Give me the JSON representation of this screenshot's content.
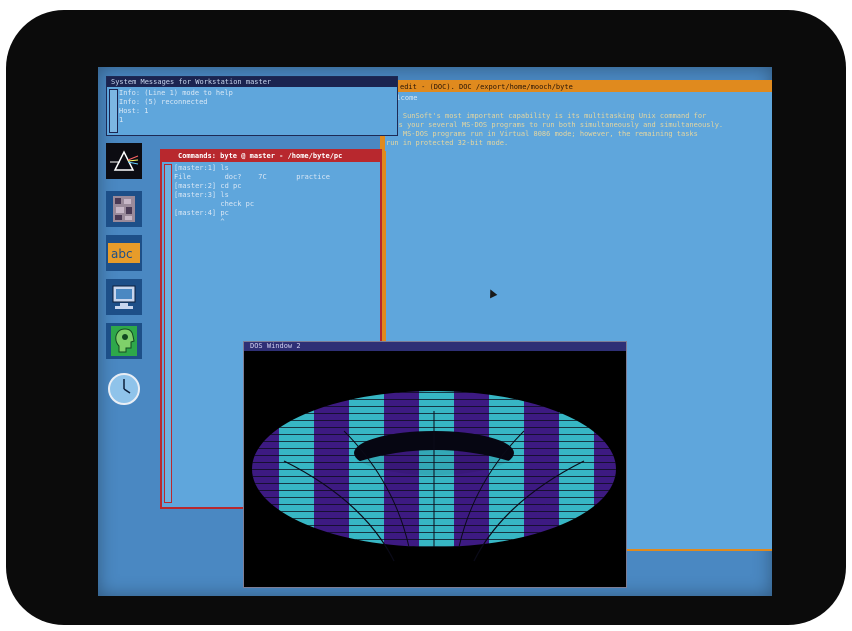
{
  "system_messages": {
    "title": "System Messages for Workstation master",
    "lines": [
      "Info: (Line 1) mode to help",
      "Info: (5) reconnected",
      "Host: 1",
      "1"
    ]
  },
  "document": {
    "title": "edit - (DOC). DOC /export/home/mooch/byte",
    "subtitle": "Welcome",
    "body_lines": [
      "The SunSoft's most important capability is its multitasking Unix command for",
      "it's your several MS-DOS programs to run both simultaneously and simultaneously.",
      "All MS-DOS programs run in Virtual 8086 mode; however, the remaining tasks",
      "run in protected 32-bit mode."
    ]
  },
  "commands": {
    "title": "Commands: byte @ master - /home/byte/pc",
    "lines": [
      "[master:1] ls",
      "File        doc?    7C       practice",
      "[master:2] cd pc",
      "[master:3] ls",
      "           check pc",
      "[master:4] pc",
      "           ^"
    ]
  },
  "dos": {
    "title": "DOS Window 2"
  },
  "colors": {
    "screen_bg": "#4a88c2",
    "torus_dark": "#3d1a82",
    "torus_light": "#37b6c4",
    "command_border": "#b8282e",
    "document_border": "#e08a1e"
  },
  "icons": [
    "prism-icon",
    "texture-icon",
    "abc-icon",
    "monitor-icon",
    "head-icon",
    "clock-icon"
  ]
}
